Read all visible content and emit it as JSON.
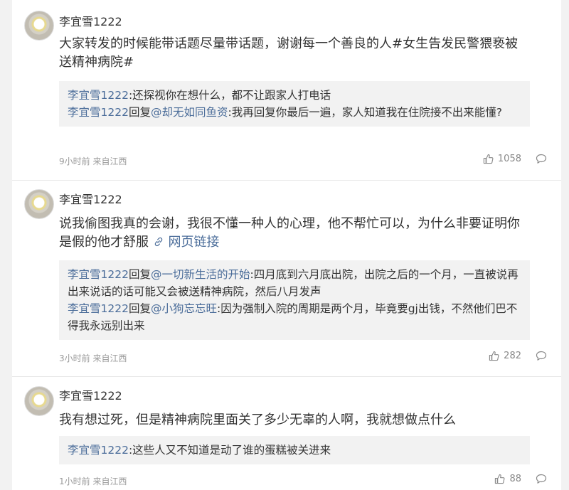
{
  "comments": [
    {
      "username": "李宜雪1222",
      "text": "大家转发的时候能带话题尽量带话题，谢谢每一个善良的人#女生告发民警猥亵被送精神病院#",
      "replies": [
        {
          "author": "李宜雪1222",
          "connector": "",
          "target": "",
          "content": ":还探视你在想什么，都不让跟家人打电话"
        },
        {
          "author": "李宜雪1222",
          "connector": "回复",
          "target": "@却无如同鱼资",
          "content": ":我再回复你最后一遍，家人知道我在住院接不出来能懂?"
        }
      ],
      "meta": "9小时前 来自江西",
      "likes": "1058"
    },
    {
      "username": "李宜雪1222",
      "text": "说我偷图我真的会谢，我很不懂一种人的心理，他不帮忙可以，为什么非要证明你是假的他才舒服",
      "link_text": "网页链接",
      "replies": [
        {
          "author": "李宜雪1222",
          "connector": "回复",
          "target": "@一切新生活的开始",
          "content": ":四月底到六月底出院，出院之后的一个月，一直被说再出来说话的话可能又会被送精神病院，然后八月发声"
        },
        {
          "author": "李宜雪1222",
          "connector": "回复",
          "target": "@小狗忘忘旺",
          "content": ":因为强制入院的周期是两个月，毕竟要gj出钱，不然他们巴不得我永远别出来"
        }
      ],
      "meta": "3小时前 来自江西",
      "likes": "282"
    },
    {
      "username": "李宜雪1222",
      "text": "我有想过死，但是精神病院里面关了多少无辜的人啊，我就想做点什么",
      "replies": [
        {
          "author": "李宜雪1222",
          "connector": "",
          "target": "",
          "content": ":这些人又不知道是动了谁的蛋糕被关进来"
        }
      ],
      "meta": "1小时前 来自江西",
      "likes": "88"
    }
  ],
  "icons": {
    "avatar": "avatar-image",
    "like": "thumbs-up-icon",
    "reply": "comment-bubble-icon",
    "link": "link-icon"
  },
  "colors": {
    "mention": "#4a6c99",
    "meta": "#999999",
    "reply_bg": "#f2f2f2"
  }
}
